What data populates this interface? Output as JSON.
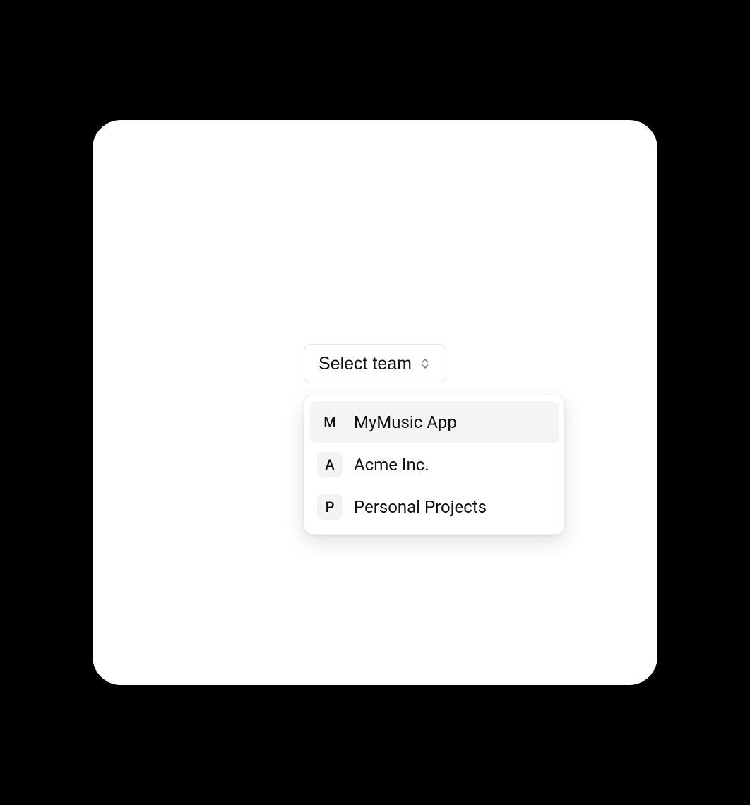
{
  "select": {
    "placeholder": "Select team"
  },
  "options": [
    {
      "initial": "M",
      "label": "MyMusic App",
      "highlighted": true
    },
    {
      "initial": "A",
      "label": "Acme Inc.",
      "highlighted": false
    },
    {
      "initial": "P",
      "label": "Personal Projects",
      "highlighted": false
    }
  ]
}
